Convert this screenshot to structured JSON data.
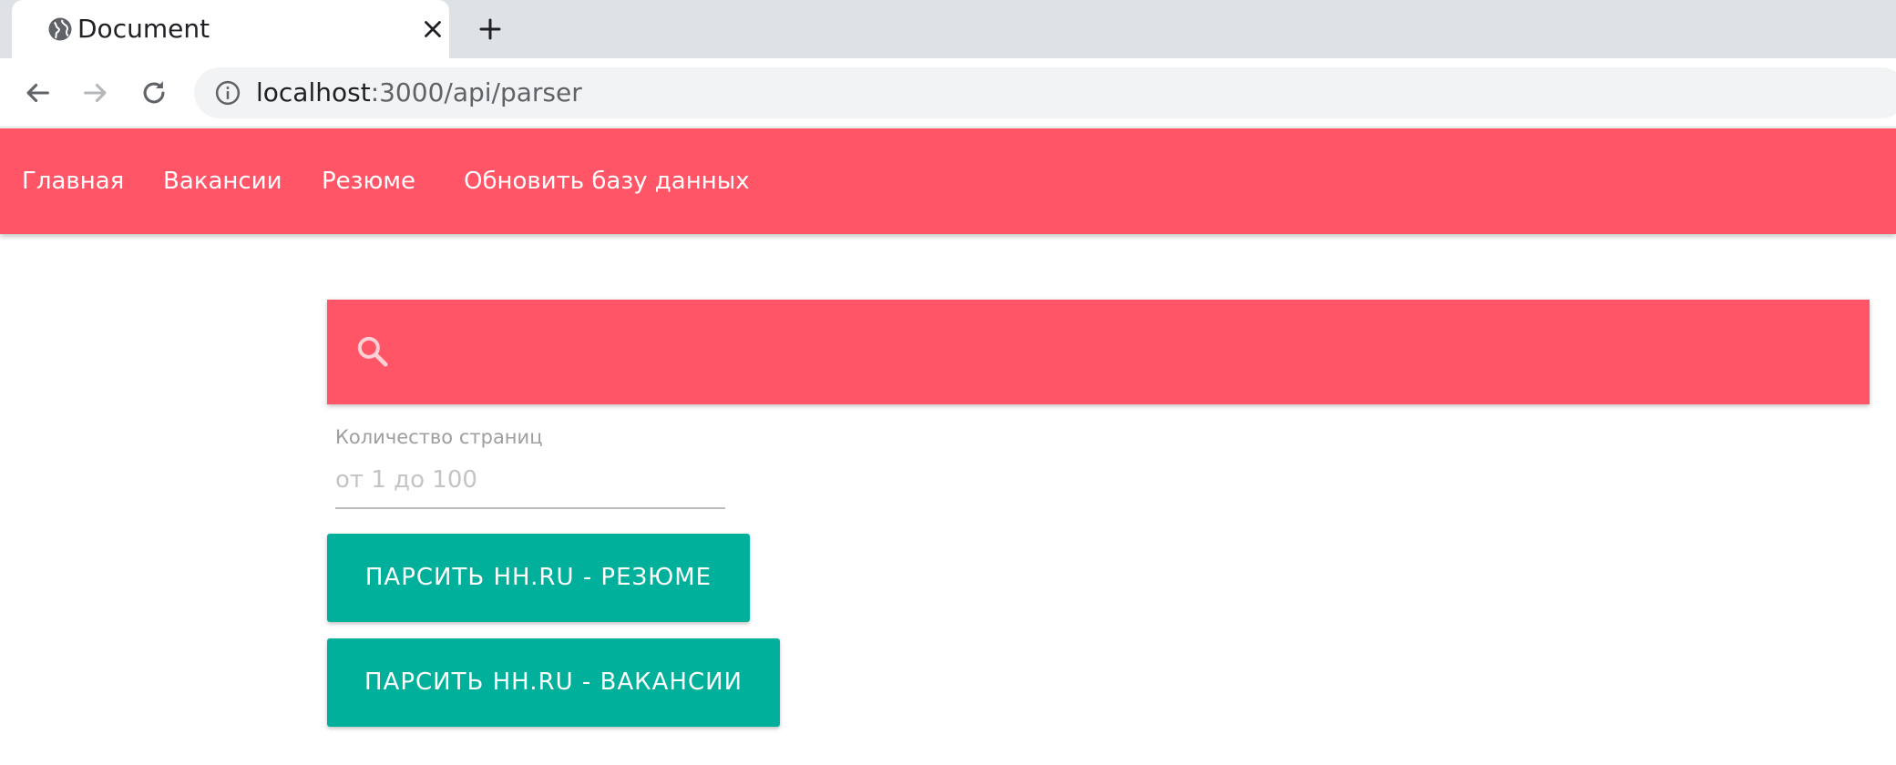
{
  "browser": {
    "tab": {
      "title": "Document",
      "favicon": "globe-icon"
    },
    "address_bar": {
      "host": "localhost",
      "path": ":3000/api/parser"
    },
    "icons": {
      "back": "arrow-left-icon",
      "forward": "arrow-right-icon",
      "reload": "reload-icon",
      "info": "info-icon",
      "close_tab": "close-icon",
      "new_tab": "plus-icon"
    }
  },
  "navbar": {
    "items": [
      {
        "label": "Главная"
      },
      {
        "label": "Вакансии"
      },
      {
        "label": "Резюме"
      },
      {
        "label": "Обновить базу данных"
      }
    ]
  },
  "search": {
    "value": "",
    "icon": "search-icon"
  },
  "pages_field": {
    "label": "Количество страниц",
    "placeholder": "от 1 до 100",
    "value": ""
  },
  "buttons": {
    "parse_resumes": "ПАРСИТЬ HH.RU - РЕЗЮМЕ",
    "parse_vacancies": "ПАРСИТЬ HH.RU - ВАКАНСИИ"
  },
  "colors": {
    "accent": "#ff5566",
    "button": "#00b09b",
    "tabstrip": "#dee1e6"
  }
}
